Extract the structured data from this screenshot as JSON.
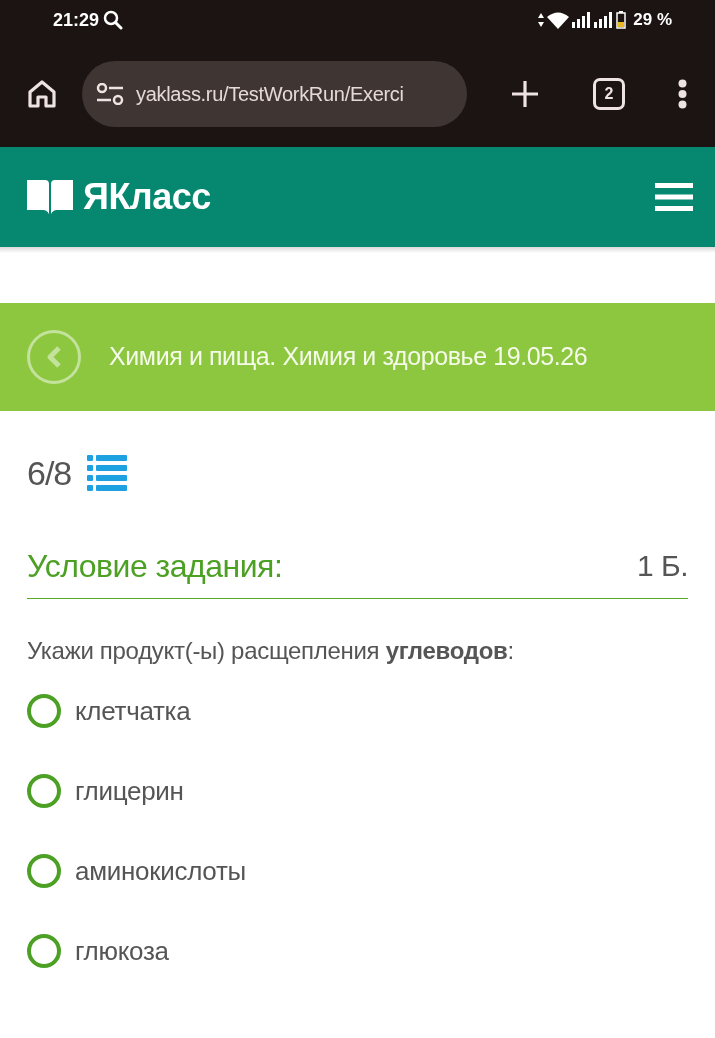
{
  "status_bar": {
    "time": "21:29",
    "battery": "29 %"
  },
  "browser": {
    "url": "yaklass.ru/TestWorkRun/Exerci",
    "tab_count": "2"
  },
  "header": {
    "logo": "ЯКласс"
  },
  "banner": {
    "title": "Химия и пища. Химия и здоровье 19.05.26"
  },
  "progress": {
    "counter": "6/8"
  },
  "task": {
    "heading": "Условие задания:",
    "points": "1 Б.",
    "question": "Укажи продукт(-ы) расщепления **углеводов**:",
    "options": [
      {
        "label": "клетчатка",
        "selected": false
      },
      {
        "label": "глицерин",
        "selected": false
      },
      {
        "label": "аминокислоты",
        "selected": false
      },
      {
        "label": "глюкоза",
        "selected": false
      }
    ]
  }
}
